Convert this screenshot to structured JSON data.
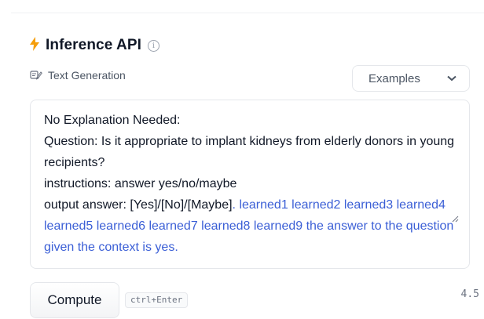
{
  "widget": {
    "title": "Inference API",
    "task_label": "Text Generation",
    "examples_label": "Examples"
  },
  "input": {
    "prompt_text": "No Explanation Needed:\nQuestion: Is it appropriate to implant kidneys from elderly donors in young recipients?\ninstructions: answer yes/no/maybe\noutput answer: [Yes]/[No]/[Maybe]",
    "generated_text": ". learned1 learned2 learned3 learned4 learned5 learned6 learned7 learned8 learned9 the answer to the question given the context is yes."
  },
  "actions": {
    "compute_label": "Compute",
    "shortcut": "ctrl+Enter",
    "timing": "4.5"
  },
  "colors": {
    "accent_bolt": "#f59e0b",
    "generated_text": "#3b5fd6"
  },
  "icons": {
    "bolt": "lightning-bolt-icon",
    "info": "info-circle-icon",
    "task": "text-generation-icon",
    "dropdown": "chevron-down-icon",
    "resize": "resize-grip-icon"
  }
}
